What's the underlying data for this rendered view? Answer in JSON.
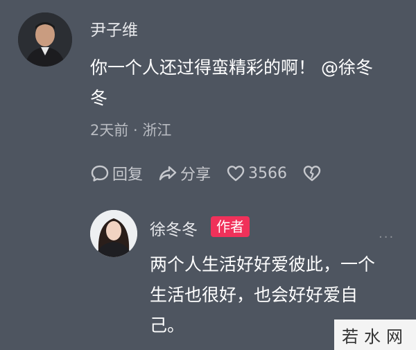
{
  "main_comment": {
    "username": "尹子维",
    "text_line1": "你一个人还过得蛮精彩的啊！ @徐冬",
    "text_line2": "冬",
    "meta": "2天前 · 浙江",
    "actions": {
      "reply_label": "回复",
      "share_label": "分享",
      "like_count": "3566"
    }
  },
  "reply": {
    "username": "徐冬冬",
    "badge": "作者",
    "more": "···",
    "text_line1": "两个人生活好好爱彼此，一个",
    "text_line2": "生活也很好，也会好好爱自",
    "text_line3": "己。"
  },
  "watermark": "若水网",
  "colors": {
    "background": "#4e5560",
    "badge": "#f0315a",
    "secondary_text": "#b9bcc2"
  }
}
